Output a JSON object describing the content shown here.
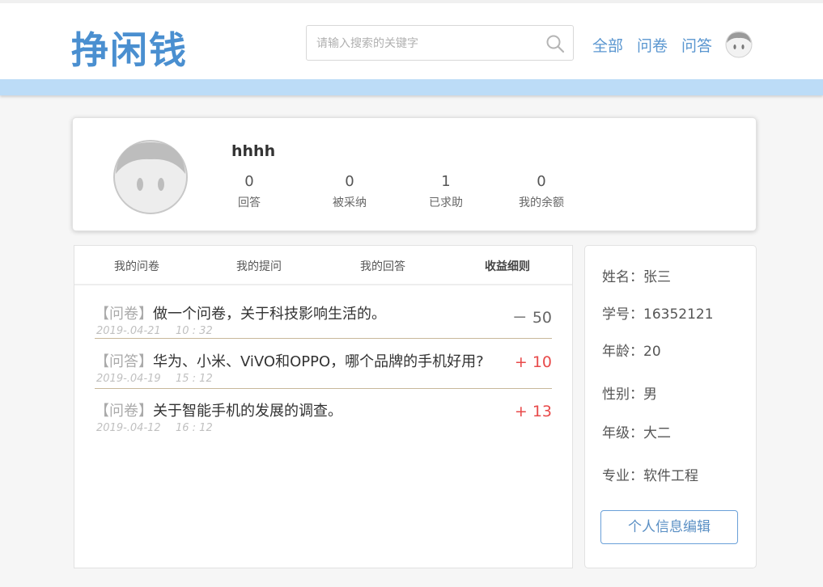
{
  "header": {
    "logo_text": "挣闲钱",
    "search_placeholder": "请输入搜索的关键字",
    "nav": [
      "全部",
      "问卷",
      "问答"
    ]
  },
  "profile": {
    "username": "hhhh",
    "stats": [
      {
        "value": "0",
        "label": "回答"
      },
      {
        "value": "0",
        "label": "被采纳"
      },
      {
        "value": "1",
        "label": "已求助"
      },
      {
        "value": "0",
        "label": "我的余额"
      }
    ]
  },
  "tabs": [
    "我的问卷",
    "我的提问",
    "我的回答",
    "收益细则"
  ],
  "records": [
    {
      "tag": "【问卷】",
      "title": "做一个问卷，关于科技影响生活的。",
      "date": "2019-.04-21",
      "time": "10 : 32",
      "amount": "－ 50"
    },
    {
      "tag": "【问答】",
      "title": "华为、小米、ViVO和OPPO，哪个品牌的手机好用?",
      "date": "2019-.04-19",
      "time": "15 : 12",
      "amount": "+ 10"
    },
    {
      "tag": "【问卷】",
      "title": "关于智能手机的发展的调查。",
      "date": "2019-.04-12",
      "time": "16 : 12",
      "amount": "+ 13"
    }
  ],
  "info": [
    "姓名：张三",
    "学号：16352121",
    "年龄：20",
    "性别：男",
    "年级：大二",
    "专业：软件工程"
  ],
  "edit_button": "个人信息编辑",
  "colors": {
    "accent": "#5a96d0",
    "bar": "#bcdcf7",
    "positive": "#e84a4a"
  }
}
